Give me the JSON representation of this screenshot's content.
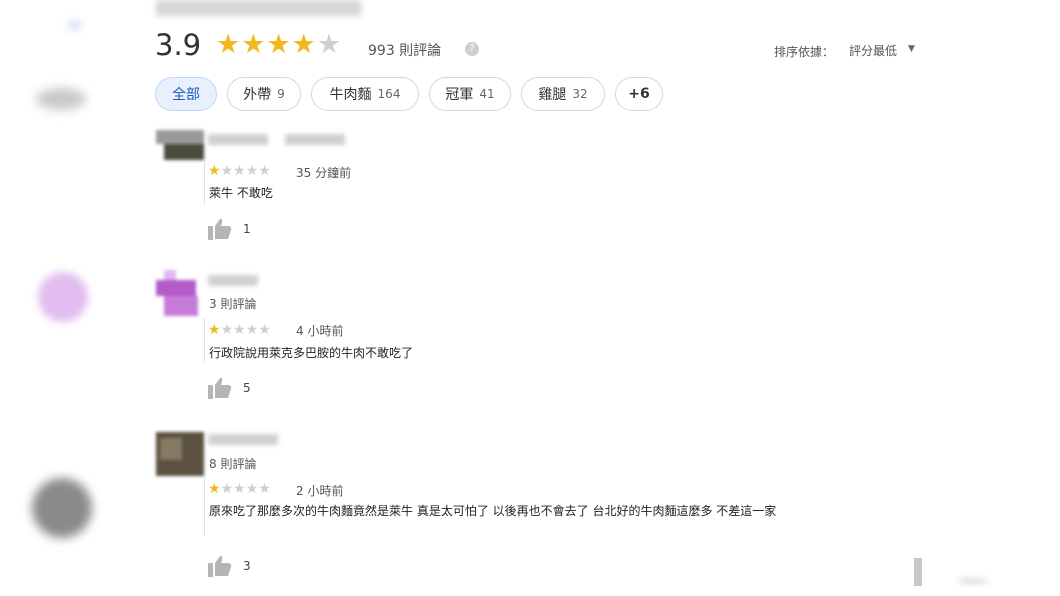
{
  "summary": {
    "rating": "3.9",
    "stars_filled": 4,
    "review_count": "993 則評論",
    "sort_label": "排序依據：",
    "sort_value": "評分最低"
  },
  "chips": [
    {
      "label": "全部",
      "count": ""
    },
    {
      "label": "外帶",
      "count": "9"
    },
    {
      "label": "牛肉麵",
      "count": "164"
    },
    {
      "label": "冠軍",
      "count": "41"
    },
    {
      "label": "雞腿",
      "count": "32"
    },
    {
      "label": "+6",
      "count": ""
    }
  ],
  "reviews": [
    {
      "meta": "",
      "stars": 1,
      "time": "35 分鐘前",
      "text": "萊牛 不敢吃",
      "likes": "1"
    },
    {
      "meta": "3 則評論",
      "stars": 1,
      "time": "4 小時前",
      "text": "行政院說用萊克多巴胺的牛肉不敢吃了",
      "likes": "5"
    },
    {
      "meta": "8 則評論",
      "stars": 1,
      "time": "2 小時前",
      "text": "原來吃了那麼多次的牛肉麵竟然是萊牛 真是太可怕了 以後再也不會去了 台北好的牛肉麵這麼多 不差這一家",
      "likes": "3"
    }
  ],
  "colors": {
    "star": "#f3b81f",
    "star_off": "#cfcfcf",
    "chip_active_bg": "#e8f0fe",
    "chip_active_text": "#1a5ab8"
  }
}
